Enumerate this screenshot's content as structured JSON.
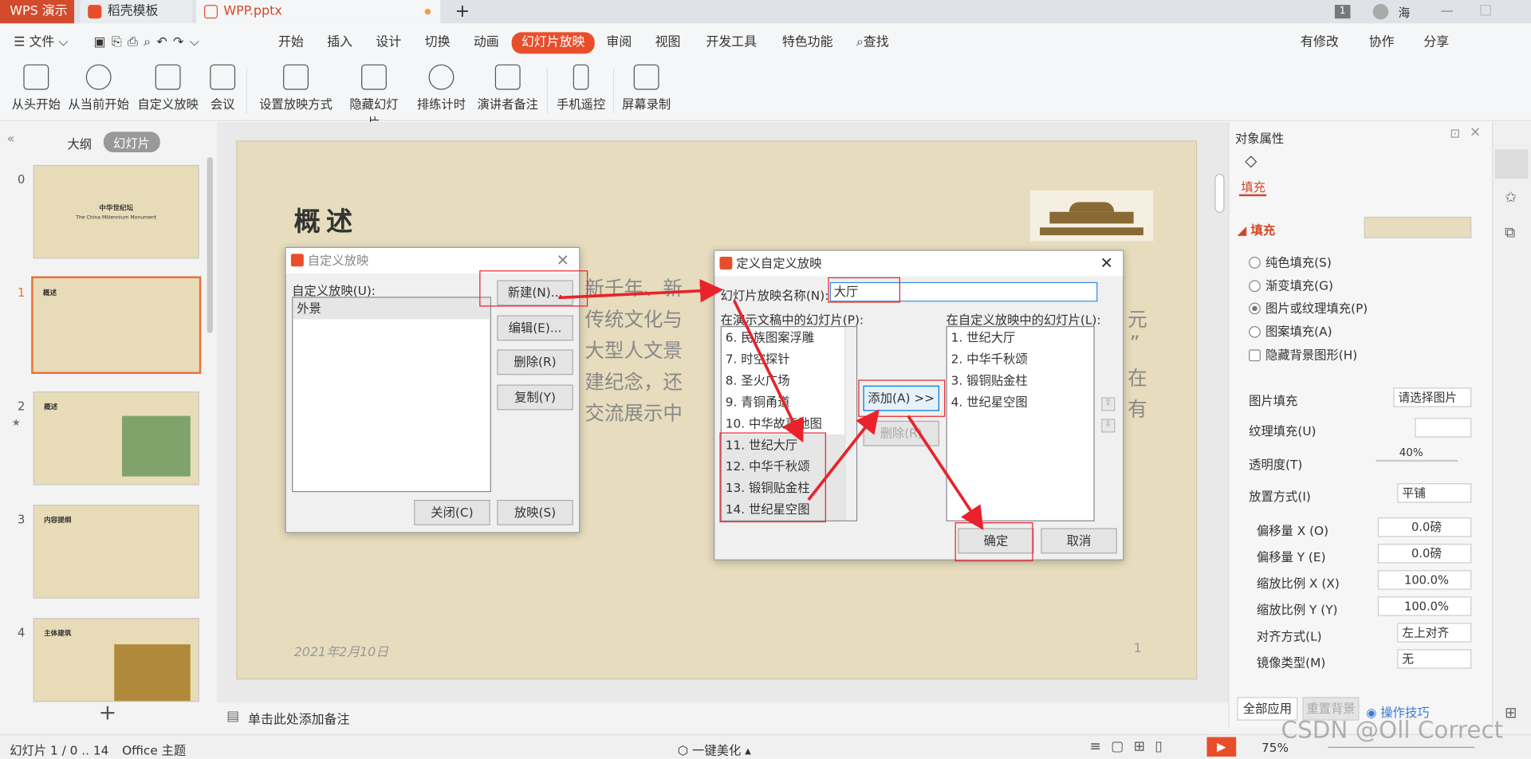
{
  "tabs": {
    "app": "WPS 演示",
    "template": "稻壳模板",
    "file": "WPP.pptx"
  },
  "titlebar": {
    "badge": "1",
    "user": "海"
  },
  "menu": {
    "file": "文件",
    "items": [
      "开始",
      "插入",
      "设计",
      "切换",
      "动画",
      "幻灯片放映",
      "审阅",
      "视图",
      "开发工具",
      "特色功能"
    ],
    "search": "查找",
    "right": [
      "有修改",
      "协作",
      "分享"
    ]
  },
  "ribbon": [
    "从头开始",
    "从当前开始",
    "自定义放映",
    "会议",
    "设置放映方式",
    "隐藏幻灯片",
    "排练计时",
    "演讲者备注",
    "手机遥控",
    "屏幕录制"
  ],
  "leftpane": {
    "tab_outline": "大纲",
    "tab_slides": "幻灯片",
    "nums": [
      "0",
      "1",
      "2",
      "3",
      "4"
    ],
    "t0_title": "中华世纪坛",
    "t0_sub": "The China Millennium Monument",
    "t1_title": "概述",
    "t2_title": "概述",
    "t3_title": "内容提纲",
    "t4_title": "主体建筑"
  },
  "slide": {
    "title": "概述",
    "lines": [
      "新千年、新",
      "传统文化与",
      "大型人文景",
      "建纪念，还",
      "交流展示中"
    ],
    "right_chars": [
      "元",
      "”",
      "在",
      "有"
    ],
    "date": "2021年2月10日",
    "page": "1"
  },
  "dlg1": {
    "title": "自定义放映",
    "label": "自定义放映(U):",
    "item": "外景",
    "new": "新建(N)...",
    "edit": "编辑(E)...",
    "delete": "删除(R)",
    "copy": "复制(Y)",
    "close": "关闭(C)",
    "show": "放映(S)"
  },
  "dlg2": {
    "title": "定义自定义放映",
    "name_label": "幻灯片放映名称(N):",
    "name_value": "大厅",
    "left_label": "在演示文稿中的幻灯片(P):",
    "right_label": "在自定义放映中的幻灯片(L):",
    "left_items": [
      "6. 民族图案浮雕",
      "7. 时空探针",
      "8. 圣火广场",
      "9. 青铜甬道",
      "10. 中华故事地图",
      "11. 世纪大厅",
      "12. 中华千秋颂",
      "13. 锻铜贴金柱",
      "14. 世纪星空图"
    ],
    "right_items": [
      "1. 世纪大厅",
      "2. 中华千秋颂",
      "3. 锻铜贴金柱",
      "4. 世纪星空图"
    ],
    "add": "添加(A) >>",
    "remove": "删除(R)",
    "ok": "确定",
    "cancel": "取消"
  },
  "rightpane": {
    "title": "对象属性",
    "tab": "填充",
    "section": "填充",
    "opts": [
      "纯色填充(S)",
      "渐变填充(G)",
      "图片或纹理填充(P)",
      "图案填充(A)",
      "隐藏背景图形(H)"
    ],
    "pic_fill": "图片填充",
    "pic_fill_val": "请选择图片",
    "texture": "纹理填充(U)",
    "transparency": "透明度(T)",
    "trans_val": "40%",
    "placement": "放置方式(I)",
    "placement_val": "平铺",
    "offx": "偏移量 X (O)",
    "offx_val": "0.0磅",
    "offy": "偏移量 Y (E)",
    "offy_val": "0.0磅",
    "scalex": "缩放比例 X (X)",
    "scalex_val": "100.0%",
    "scaley": "缩放比例 Y (Y)",
    "scaley_val": "100.0%",
    "align": "对齐方式(L)",
    "align_val": "左上对齐",
    "mirror": "镜像类型(M)",
    "mirror_val": "无",
    "apply_all": "全部应用",
    "reset_bg": "重置背景",
    "tips": "操作技巧"
  },
  "notes": "单击此处添加备注",
  "status": {
    "slides": "幻灯片 1 / 0 .. 14",
    "theme": "Office 主题",
    "beautify": "一键美化",
    "zoom": "75%"
  },
  "watermark": "CSDN @Oll Correct",
  "colors": {
    "accent": "#e94e2a",
    "red": "#e8232b",
    "slide_bg": "#e7dcbd"
  }
}
